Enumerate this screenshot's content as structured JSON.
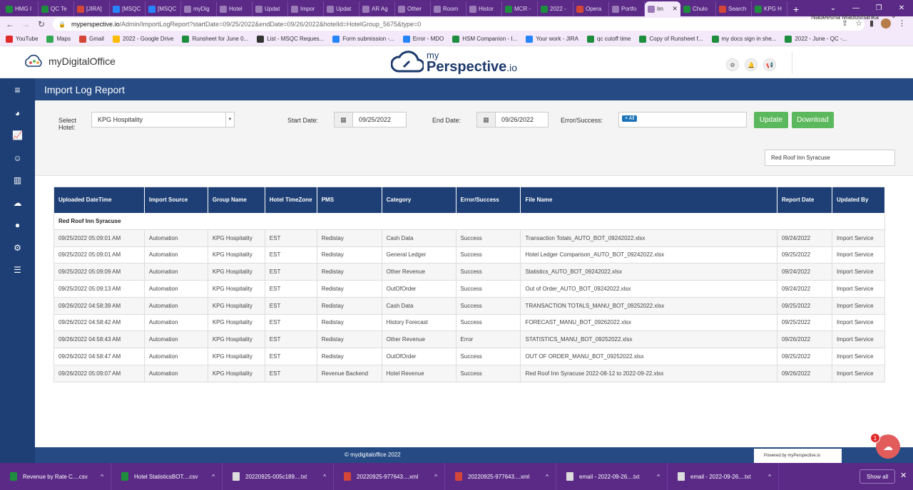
{
  "browser": {
    "tabs": [
      {
        "label": "HMG I",
        "color": "#1e8e3e"
      },
      {
        "label": "QC Te",
        "color": "#1e8e3e"
      },
      {
        "label": "[JIRA]",
        "color": "#d44638"
      },
      {
        "label": "[MSQC",
        "color": "#2684ff"
      },
      {
        "label": "[MSQC",
        "color": "#2684ff"
      },
      {
        "label": "myDig",
        "color": "#9b7ab8"
      },
      {
        "label": "Hotel",
        "color": "#9b7ab8"
      },
      {
        "label": "Updat",
        "color": "#9b7ab8"
      },
      {
        "label": "Impor",
        "color": "#9b7ab8"
      },
      {
        "label": "Updat",
        "color": "#9b7ab8"
      },
      {
        "label": "AR Ag",
        "color": "#9b7ab8"
      },
      {
        "label": "Other",
        "color": "#9b7ab8"
      },
      {
        "label": "Room",
        "color": "#9b7ab8"
      },
      {
        "label": "Histor",
        "color": "#9b7ab8"
      },
      {
        "label": "MCR -",
        "color": "#1e8e3e"
      },
      {
        "label": "2022 -",
        "color": "#1e8e3e"
      },
      {
        "label": "Opera",
        "color": "#d44638"
      },
      {
        "label": "Portfo",
        "color": "#9b7ab8"
      },
      {
        "label": "Im",
        "color": "#9b7ab8",
        "active": true
      },
      {
        "label": "Chulo",
        "color": "#1e8e3e"
      },
      {
        "label": "Search",
        "color": "#d44638"
      },
      {
        "label": "KPG H",
        "color": "#1e8e3e"
      }
    ],
    "url_host": "myperspective.io",
    "url_path": "/Admin/ImportLogReport?startDate=09/25/2022&endDate=09/26/2022&hotelId=HotelGroup_5675&type=0",
    "bookmarks": [
      {
        "label": "YouTube",
        "color": "#e02a2a"
      },
      {
        "label": "Maps",
        "color": "#34a853"
      },
      {
        "label": "Gmail",
        "color": "#d44638"
      },
      {
        "label": "2022 - Google Drive",
        "color": "#fbbc04"
      },
      {
        "label": "Runsheet for June 0...",
        "color": "#1e8e3e"
      },
      {
        "label": "List - MSQC Reques...",
        "color": "#333333"
      },
      {
        "label": "Form submission -...",
        "color": "#2684ff"
      },
      {
        "label": "Error - MDO",
        "color": "#2684ff"
      },
      {
        "label": "HSM Companion - I...",
        "color": "#1e8e3e"
      },
      {
        "label": "Your work - JIRA",
        "color": "#2684ff"
      },
      {
        "label": "qc cutoff time",
        "color": "#1e8e3e"
      },
      {
        "label": "Copy of Runsheet f...",
        "color": "#1e8e3e"
      },
      {
        "label": "my docs sign in she...",
        "color": "#1e8e3e"
      },
      {
        "label": "2022 - June - QC -...",
        "color": "#1e8e3e"
      }
    ]
  },
  "header": {
    "left_brand": "myDigitalOffice",
    "center_my": "my",
    "center_brand": "Perspective",
    "center_tld": ".io",
    "user": "Nadeesha Madushanka"
  },
  "page": {
    "title": "Import Log Report",
    "filters": {
      "hotel_label_1": "Select",
      "hotel_label_2": "Hotel:",
      "hotel_value": "KPG Hospitality",
      "start_label": "Start Date:",
      "start_value": "09/25/2022",
      "end_label": "End Date:",
      "end_value": "09/26/2022",
      "err_label": "Error/Success:",
      "err_tag": "× All",
      "update": "Update",
      "download": "Download"
    },
    "search_value": "Red Roof Inn Syracuse"
  },
  "table": {
    "headers": [
      "Uploaded DateTime",
      "Import Source",
      "Group Name",
      "Hotel TimeZone",
      "PMS",
      "Category",
      "Error/Success",
      "File Name",
      "Report Date",
      "Updated By"
    ],
    "group": "Red Roof Inn Syracuse",
    "rows": [
      [
        "09/25/2022 05:09:01 AM",
        "Automation",
        "KPG Hospitality",
        "EST",
        "Redistay",
        "Cash Data",
        "Success",
        "Transaction Totals_AUTO_BOT_09242022.xlsx",
        "09/24/2022",
        "Import Service"
      ],
      [
        "09/25/2022 05:09:01 AM",
        "Automation",
        "KPG Hospitality",
        "EST",
        "Redistay",
        "General Ledger",
        "Success",
        "Hotel Ledger Comparison_AUTO_BOT_09242022.xlsx",
        "09/25/2022",
        "Import Service"
      ],
      [
        "09/25/2022 05:09:09 AM",
        "Automation",
        "KPG Hospitality",
        "EST",
        "Redistay",
        "Other Revenue",
        "Success",
        "Statistics_AUTO_BOT_09242022.xlsx",
        "09/24/2022",
        "Import Service"
      ],
      [
        "09/25/2022 05:09:13 AM",
        "Automation",
        "KPG Hospitality",
        "EST",
        "Redistay",
        "OutOfOrder",
        "Success",
        "Out of Order_AUTO_BOT_09242022.xlsx",
        "09/24/2022",
        "Import Service"
      ],
      [
        "09/26/2022 04:58:39 AM",
        "Automation",
        "KPG Hospitality",
        "EST",
        "Redistay",
        "Cash Data",
        "Success",
        "TRANSACTION TOTALS_MANU_BOT_09252022.xlsx",
        "09/25/2022",
        "Import Service"
      ],
      [
        "09/26/2022 04:58:42 AM",
        "Automation",
        "KPG Hospitality",
        "EST",
        "Redistay",
        "History Forecast",
        "Success",
        "FORECAST_MANU_BOT_09262022.xlsx",
        "09/25/2022",
        "Import Service"
      ],
      [
        "09/26/2022 04:58:43 AM",
        "Automation",
        "KPG Hospitality",
        "EST",
        "Redistay",
        "Other Revenue",
        "Error",
        "STATISTICS_MANU_BOT_09252022.xlsx",
        "09/26/2022",
        "Import Service"
      ],
      [
        "09/26/2022 04:58:47 AM",
        "Automation",
        "KPG Hospitality",
        "EST",
        "Redistay",
        "OutOfOrder",
        "Success",
        "OUT OF ORDER_MANU_BOT_09252022.xlsx",
        "09/25/2022",
        "Import Service"
      ],
      [
        "09/26/2022 05:09:07 AM",
        "Automation",
        "KPG Hospitality",
        "EST",
        "Revenue Backend",
        "Hotel Revenue",
        "Success",
        "Red Roof Inn Syracuse 2022-08-12 to 2022-09-22.xlsx",
        "09/26/2022",
        "Import Service"
      ]
    ]
  },
  "footer": {
    "copyright": "© mydigitaloffice 2022",
    "powered": "Powered by myPerspective.io",
    "chat_badge": "1"
  },
  "downloads": {
    "items": [
      {
        "label": "Revenue by Rate C....csv",
        "color": "#1e8e3e"
      },
      {
        "label": "Hotel StatisticsBOT....csv",
        "color": "#1e8e3e"
      },
      {
        "label": "20220925-005c189....txt",
        "color": "#dddddd"
      },
      {
        "label": "20220925-977643....xml",
        "color": "#d44638"
      },
      {
        "label": "20220925-977643....xml",
        "color": "#d44638"
      },
      {
        "label": "email - 2022-09-26....txt",
        "color": "#dddddd"
      },
      {
        "label": "email - 2022-09-26....txt",
        "color": "#dddddd"
      }
    ],
    "show_all": "Show all"
  }
}
